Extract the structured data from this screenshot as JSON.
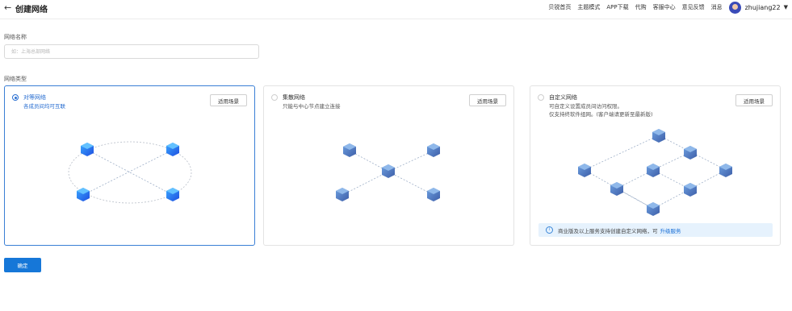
{
  "header": {
    "back_icon": "arrow-left-icon",
    "title": "创建网络",
    "nav": [
      "贝锐首页",
      "主题模式",
      "APP下载",
      "代购",
      "客服中心",
      "意见反馈",
      "消息"
    ],
    "username": "zhujiang22"
  },
  "form": {
    "name_label": "网络名称",
    "name_placeholder": "如：上海总部网络",
    "name_value": "",
    "type_label": "网络类型"
  },
  "cards": {
    "peer": {
      "title": "对等网络",
      "desc": "各成员间均可互联",
      "button": "适用场景",
      "selected": true
    },
    "star": {
      "title": "集散网络",
      "desc": "只能与中心节点建立连接",
      "button": "适用场景",
      "selected": false
    },
    "custom": {
      "title": "自定义网络",
      "desc_line1": "可自定义设置成员间访问权限。",
      "desc_line2": "仅支持终软件组网。(客户端请更新至最新版)",
      "button": "适用场景",
      "selected": false,
      "notice": "商业版及以上服务支持创建自定义网络，可",
      "notice_link": "升级服务"
    }
  },
  "actions": {
    "confirm": "确定"
  },
  "colors": {
    "accent": "#1677d8",
    "selected_border": "#3a7fd5",
    "notice_bg": "#e6f2fd"
  }
}
